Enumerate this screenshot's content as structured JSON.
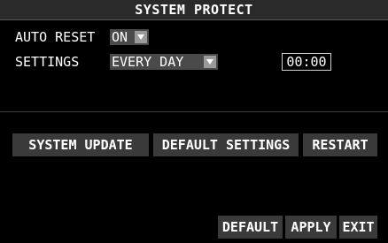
{
  "window": {
    "title": "SYSTEM PROTECT"
  },
  "auto_reset": {
    "label": "AUTO RESET",
    "value": "ON"
  },
  "settings": {
    "label": "SETTINGS",
    "value": "EVERY DAY",
    "time": "00:00"
  },
  "actions": {
    "system_update": "SYSTEM UPDATE",
    "default_settings": "DEFAULT SETTINGS",
    "restart": "RESTART"
  },
  "footer": {
    "default": "DEFAULT",
    "apply": "APPLY",
    "exit": "EXIT"
  },
  "icons": {
    "dropdown": "chevron-down-icon"
  },
  "colors": {
    "background": "#000000",
    "title_bar": "#2a2a2a",
    "button": "#3a3a3a",
    "select": "#4a4a4a",
    "text": "#ffffff"
  }
}
